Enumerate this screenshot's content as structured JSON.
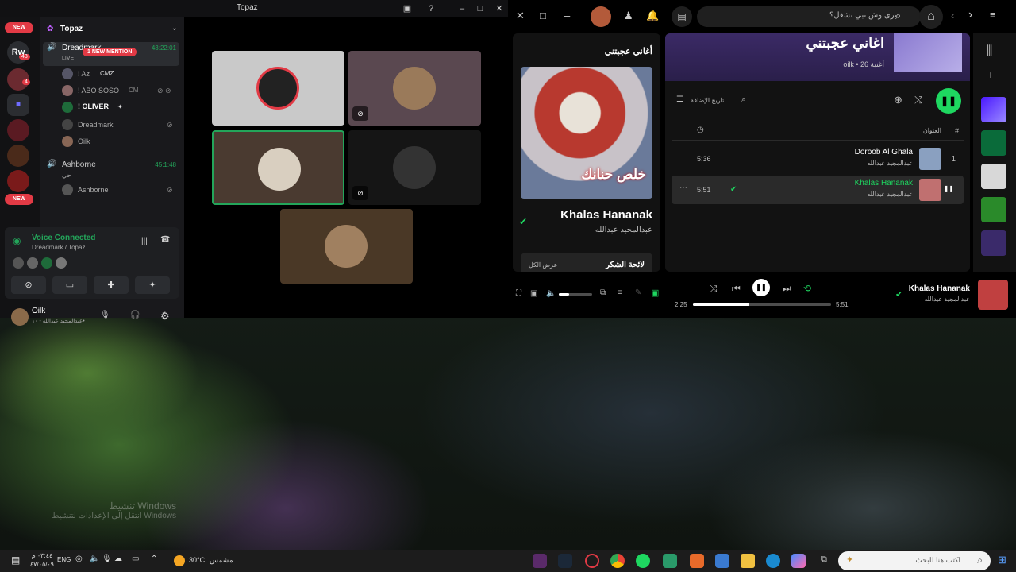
{
  "discord": {
    "window_title": "Topaz",
    "badges": {
      "new_top": "NEW",
      "new_bottom": "NEW",
      "mention": "1 NEW MENTION",
      "count_1": "43",
      "count_2": "4",
      "rw": "Rw"
    },
    "server_name": "Topaz",
    "channels": [
      {
        "name": "Dreadmark",
        "live": "LIVE",
        "time": "43:22:01"
      },
      {
        "name": "Ashborne",
        "time": "45:1:48"
      }
    ],
    "members": [
      {
        "name": "! Az",
        "tag": "CMZ"
      },
      {
        "name": "! ABO SOSO",
        "tag": "CM"
      },
      {
        "name": "! OLIVER",
        "tag": "✦"
      },
      {
        "name": "Dreadmark",
        "tag": ""
      },
      {
        "name": "Oilk",
        "tag": ""
      },
      {
        "name": "Ashborne",
        "tag": ""
      }
    ],
    "ashborne_sub": "حي",
    "voice": {
      "title": "Voice Connected",
      "sub": "Dreadmark / Topaz"
    },
    "user": {
      "name": "Oilk",
      "status": "عبدالمجيد عبدالله - ١٠•"
    }
  },
  "spotify": {
    "search_placeholder": "ترى وش تبي تشغل؟",
    "now_playing_header": "أغاني عجبتني",
    "cover_text": "خلص حنانك",
    "track_title": "Khalas Hananak",
    "track_artist": "عبدالمجيد عبدالله",
    "credits_label": "لائحة الشكر",
    "show_all": "عرض الكل",
    "playlist": {
      "title": "اغاني عجبتني",
      "meta": "oilk • 26 أغنية",
      "sort_label": "تاريخ الإضافة",
      "col_hash": "#",
      "col_title": "العنوان",
      "tracks": [
        {
          "num": "1",
          "title": "Doroob Al Ghala",
          "artist": "عبدالمجيد عبدالله",
          "duration": "5:36",
          "active": false
        },
        {
          "num": "",
          "title": "Khalas Hananak",
          "artist": "عبدالمجيد عبدالله",
          "duration": "5:51",
          "active": true
        }
      ]
    },
    "player": {
      "elapsed": "2:25",
      "total": "5:51",
      "title": "Khalas Hananak",
      "artist": "عبدالمجيد عبدالله",
      "progress": 0.41,
      "volume": 0.3
    }
  },
  "desktop": {
    "watermark_line1": "تنشيط Windows",
    "watermark_line2": "انتقل إلى الإعدادات لتنشيط Windows"
  },
  "taskbar": {
    "search_placeholder": "اكتب هنا للبحث",
    "weather_temp": "30°C",
    "weather_label": "مشمس",
    "lang": "ENG",
    "time": "٠٣:٤٤ م",
    "date": "٤٧/٠٥/٠٩"
  }
}
